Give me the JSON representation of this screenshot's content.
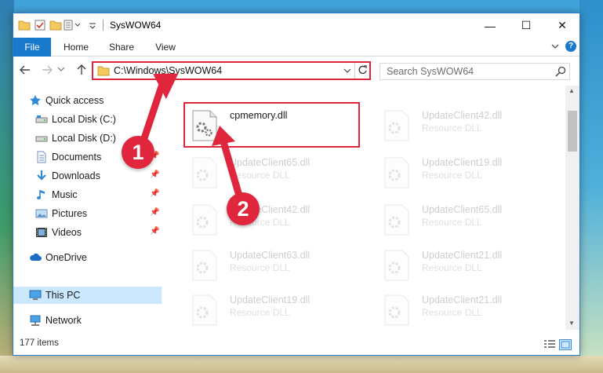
{
  "window": {
    "title": "SysWOW64",
    "controls": {
      "minimize": "—",
      "maximize": "☐",
      "close": "✕"
    }
  },
  "ribbon": {
    "tabs": [
      "File",
      "Home",
      "Share",
      "View"
    ],
    "help": "?"
  },
  "address": {
    "path": "C:\\Windows\\SysWOW64",
    "search_placeholder": "Search SysWOW64"
  },
  "sidebar": {
    "items": [
      {
        "label": "Quick access",
        "icon": "star-icon",
        "pinned": false
      },
      {
        "label": "Local Disk (C:)",
        "icon": "drive-icon",
        "pinned": false
      },
      {
        "label": "Local Disk (D:)",
        "icon": "drive-icon",
        "pinned": false
      },
      {
        "label": "Documents",
        "icon": "documents-icon",
        "pinned": true
      },
      {
        "label": "Downloads",
        "icon": "download-icon",
        "pinned": true
      },
      {
        "label": "Music",
        "icon": "music-icon",
        "pinned": true
      },
      {
        "label": "Pictures",
        "icon": "pictures-icon",
        "pinned": true
      },
      {
        "label": "Videos",
        "icon": "videos-icon",
        "pinned": true
      },
      {
        "label": "OneDrive",
        "icon": "cloud-icon",
        "pinned": false
      },
      {
        "label": "This PC",
        "icon": "computer-icon",
        "pinned": false,
        "selected": true
      },
      {
        "label": "Network",
        "icon": "network-icon",
        "pinned": false
      }
    ]
  },
  "files": [
    {
      "name": "cpmemory.dll",
      "type": "",
      "highlighted": true
    },
    {
      "name": "UpdateClient42.dll",
      "type": "Resource DLL"
    },
    {
      "name": "UpdateClient65.dll",
      "type": "Resource DLL"
    },
    {
      "name": "UpdateClient19.dll",
      "type": "Resource DLL"
    },
    {
      "name": "UpdateClient42.dll",
      "type": "Resource DLL"
    },
    {
      "name": "UpdateClient65.dll",
      "type": "Resource DLL"
    },
    {
      "name": "UpdateClient63.dll",
      "type": "Resource DLL"
    },
    {
      "name": "UpdateClient21.dll",
      "type": "Resource DLL"
    },
    {
      "name": "UpdateClient19.dll",
      "type": "Resource DLL"
    },
    {
      "name": "UpdateClient21.dll",
      "type": "Resource DLL"
    }
  ],
  "status": {
    "item_count": "177 items"
  },
  "annotations": {
    "step1": "1",
    "step2": "2",
    "color": "#e0263c"
  }
}
